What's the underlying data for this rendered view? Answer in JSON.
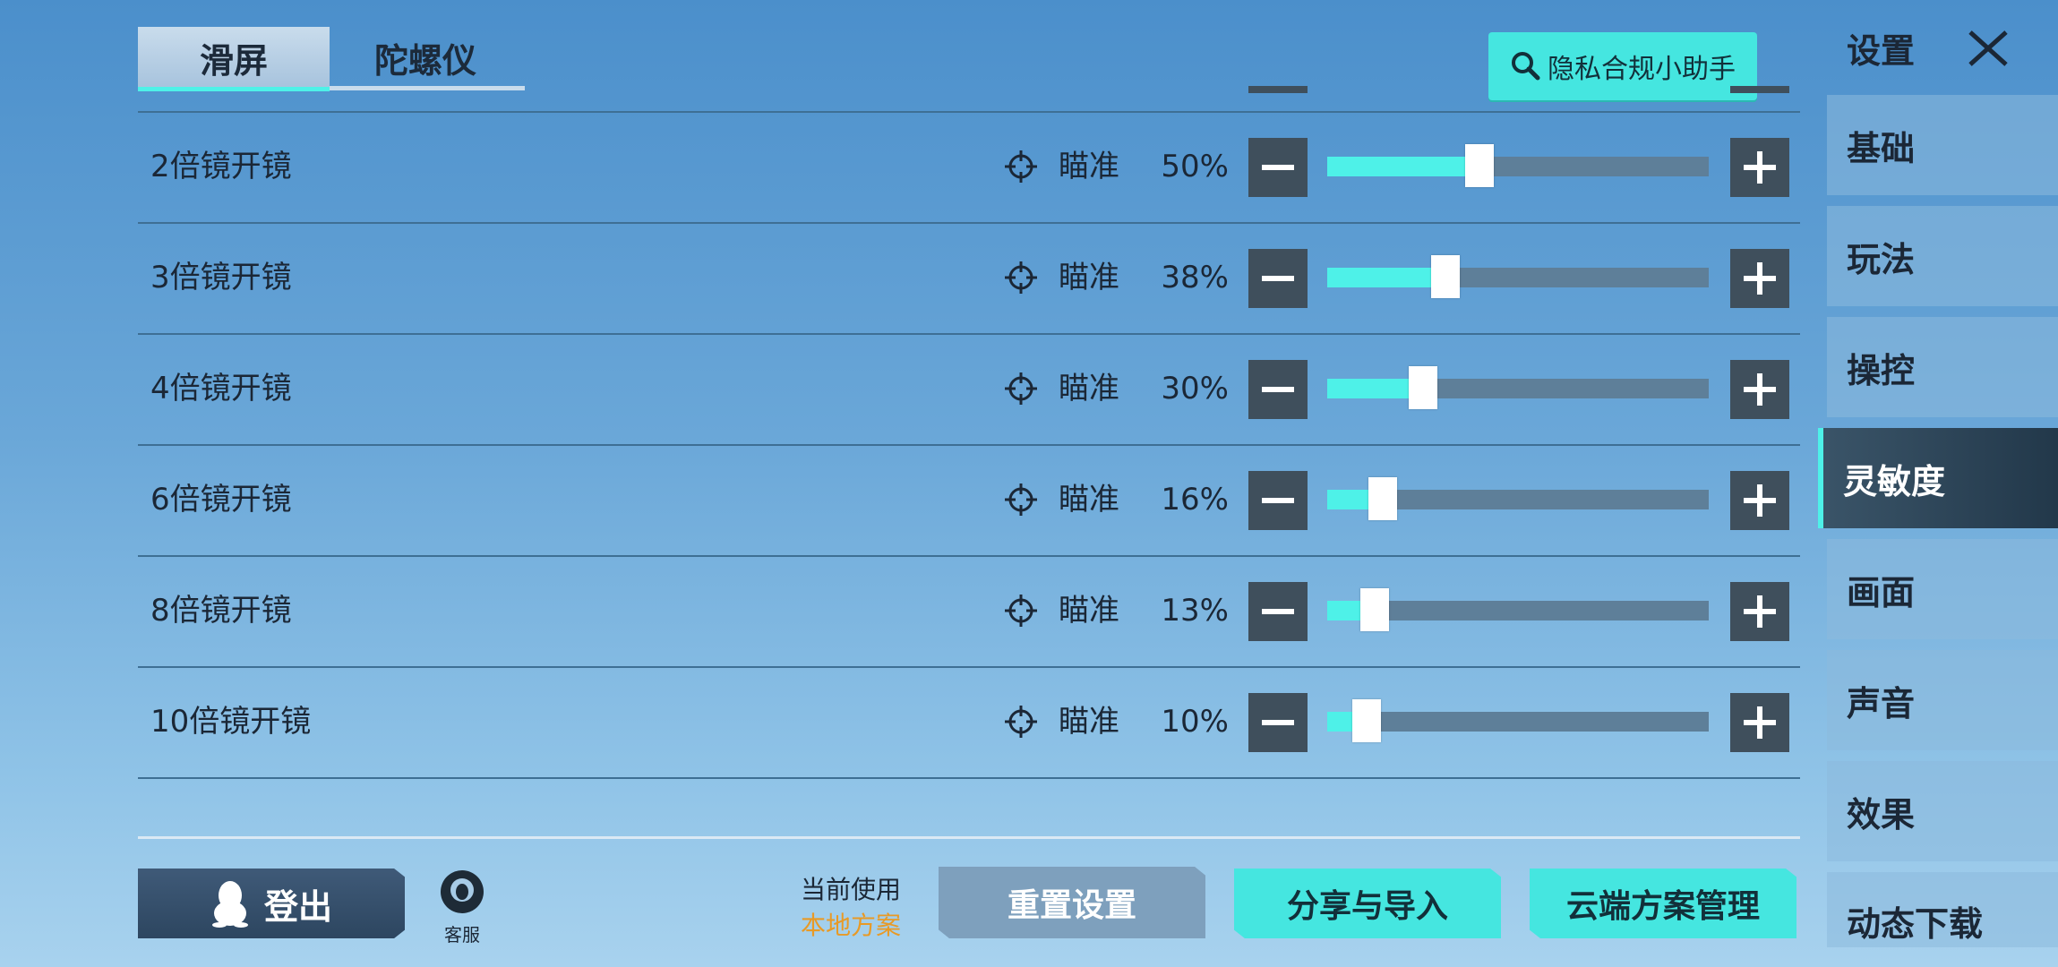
{
  "tabs": {
    "slide": "滑屏",
    "gyro": "陀螺仪"
  },
  "privacy_button": "隐私合规小助手",
  "rows": [
    {
      "label": "2倍镜开镜",
      "aim": "瞄准",
      "percent": "50%",
      "value": 0.5
    },
    {
      "label": "3倍镜开镜",
      "aim": "瞄准",
      "percent": "38%",
      "value": 0.38
    },
    {
      "label": "4倍镜开镜",
      "aim": "瞄准",
      "percent": "30%",
      "value": 0.3
    },
    {
      "label": "6倍镜开镜",
      "aim": "瞄准",
      "percent": "16%",
      "value": 0.16
    },
    {
      "label": "8倍镜开镜",
      "aim": "瞄准",
      "percent": "13%",
      "value": 0.13
    },
    {
      "label": "10倍镜开镜",
      "aim": "瞄准",
      "percent": "10%",
      "value": 0.1
    }
  ],
  "bottom": {
    "logout": "登出",
    "service": "客服",
    "current_use_label": "当前使用",
    "current_scheme": "本地方案",
    "reset": "重置设置",
    "share_import": "分享与导入",
    "cloud_manage": "云端方案管理"
  },
  "sidebar": {
    "title": "设置",
    "items": [
      "基础",
      "玩法",
      "操控",
      "灵敏度",
      "画面",
      "声音",
      "效果",
      "动态下载"
    ],
    "active": "灵敏度"
  },
  "colors": {
    "accent": "#4ef1e8",
    "button_dark": "#3f4f5c",
    "highlight_text": "#e89a26"
  }
}
